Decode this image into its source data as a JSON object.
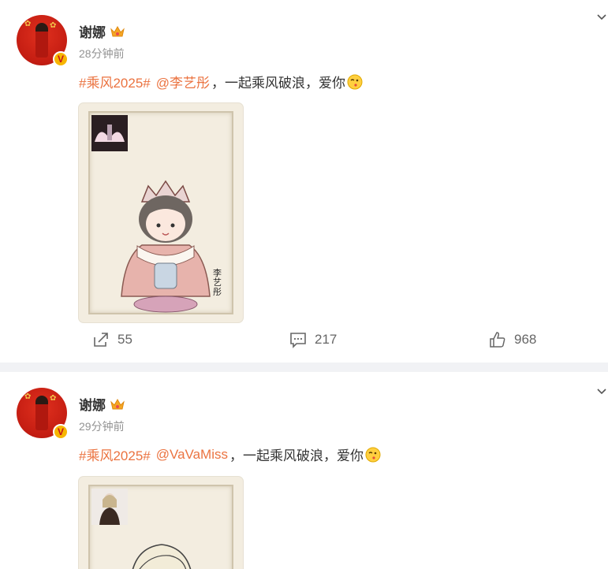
{
  "posts": [
    {
      "author": "谢娜",
      "time": "28分钟前",
      "topic": "#乘风2025#",
      "mention": "@李艺彤",
      "text": "，一起乘风破浪，爱你",
      "image_signature": "李艺彤",
      "share_count": "55",
      "comment_count": "217",
      "like_count": "968"
    },
    {
      "author": "谢娜",
      "time": "29分钟前",
      "topic": "#乘风2025#",
      "mention": "@VaVaMiss",
      "text": "，一起乘风破浪，爱你"
    }
  ],
  "colors": {
    "link": "#eb7340",
    "text": "#333333",
    "muted": "#939393",
    "divider": "#f1f2f5"
  }
}
